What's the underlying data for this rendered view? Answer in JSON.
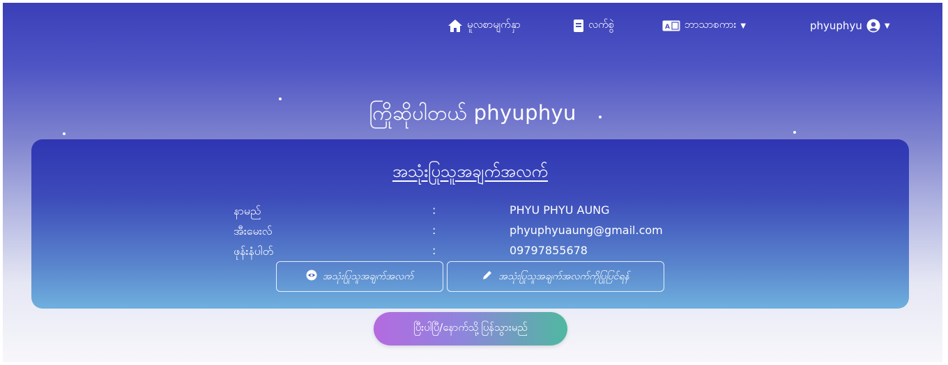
{
  "nav": {
    "home_label": "မူလစာမျက်နှာ",
    "book_label": "လက်စွဲ",
    "language_label": "ဘာသာစကား",
    "user_label": "phyuphyu",
    "icons": {
      "home": "home-icon",
      "book": "book-icon",
      "language": "language-card-icon",
      "user": "user-circle-icon"
    }
  },
  "greeting": "ကြိုဆိုပါတယ် phyuphyu",
  "profile": {
    "title": "အသုံးပြုသူအချက်အလက်",
    "rows": [
      {
        "key": "နာမည်",
        "sep": ":",
        "value": "PHYU PHYU AUNG"
      },
      {
        "key": "အီးမေးလ်",
        "sep": ":",
        "value": "phyuphyuaung@gmail.com"
      },
      {
        "key": "ဖုန်းနံပါတ်",
        "sep": ":",
        "value": "09797855678"
      }
    ],
    "view_button": "အသုံးပြုသူအချက်အလက်",
    "edit_button": "အသုံးပြုသူအချက်အလက်ကိုပြုပြင်ရန်"
  },
  "back_button": "ပြီးပါပြီ/နောက်သို့ပြန်သွားမည်"
}
